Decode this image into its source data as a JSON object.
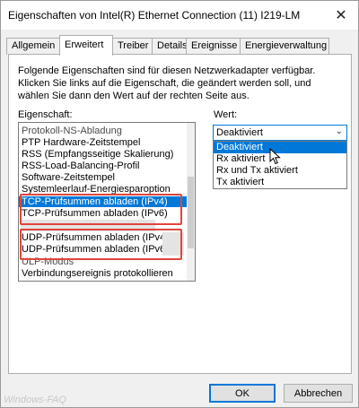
{
  "window": {
    "title": "Eigenschaften von Intel(R) Ethernet Connection (11) I219-LM",
    "close_glyph": "✕"
  },
  "tabs": [
    {
      "label": "Allgemein",
      "active": false
    },
    {
      "label": "Erweitert",
      "active": true
    },
    {
      "label": "Treiber",
      "active": false
    },
    {
      "label": "Details",
      "active": false
    },
    {
      "label": "Ereignisse",
      "active": false
    },
    {
      "label": "Energieverwaltung",
      "active": false
    }
  ],
  "advanced": {
    "description": [
      "Folgende Eigenschaften sind für diesen Netzwerkadapter verfügbar.",
      "Klicken Sie links auf die Eigenschaft, die geändert werden soll, und",
      "wählen Sie dann den Wert auf der rechten Seite aus."
    ],
    "property_label": "Eigenschaft:",
    "value_label": "Wert:",
    "properties": [
      "Protokoll-NS-Abladung",
      "PTP Hardware-Zeitstempel",
      "RSS (Empfangsseitige Skalierung)",
      "RSS-Load-Balancing-Profil",
      "Software-Zeitstempel",
      "Systemleerlauf-Energiesparoption",
      "TCP-Prüfsummen abladen (IPv4)",
      "TCP-Prüfsummen abladen (IPv6)",
      "UDP-Prüfsummen abladen (IPv4)",
      "UDP-Prüfsummen abladen (IPv6)",
      "ULP-Modus",
      "Verbindungsereignis protokollieren"
    ],
    "selected_property": "TCP-Prüfsummen abladen (IPv4)",
    "value": {
      "selected": "Deaktiviert",
      "options": [
        "Deaktiviert",
        "Rx aktiviert",
        "Rx und Tx aktiviert",
        "Tx aktiviert"
      ]
    }
  },
  "buttons": {
    "ok": "OK",
    "cancel": "Abbrechen"
  },
  "watermark": "Windows-FAQ",
  "colors": {
    "selection": "#0078d7",
    "annotation_box": "#e0463c"
  }
}
